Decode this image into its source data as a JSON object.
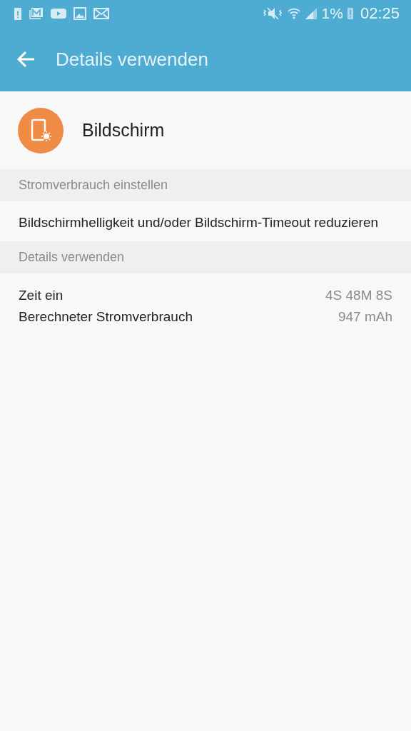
{
  "status_bar": {
    "battery_percent": "1%",
    "time": "02:25"
  },
  "app_bar": {
    "title": "Details verwenden"
  },
  "app": {
    "name": "Bildschirm"
  },
  "sections": [
    {
      "title": "Stromverbrauch einstellen",
      "kind": "text",
      "text": "Bildschirmhelligkeit und/oder Bildschirm-Timeout reduzieren"
    },
    {
      "title": "Details verwenden",
      "kind": "details",
      "rows": [
        {
          "label": "Zeit ein",
          "value": "4S 48M 8S"
        },
        {
          "label": "Berechneter Stromverbrauch",
          "value": "947 mAh"
        }
      ]
    }
  ]
}
